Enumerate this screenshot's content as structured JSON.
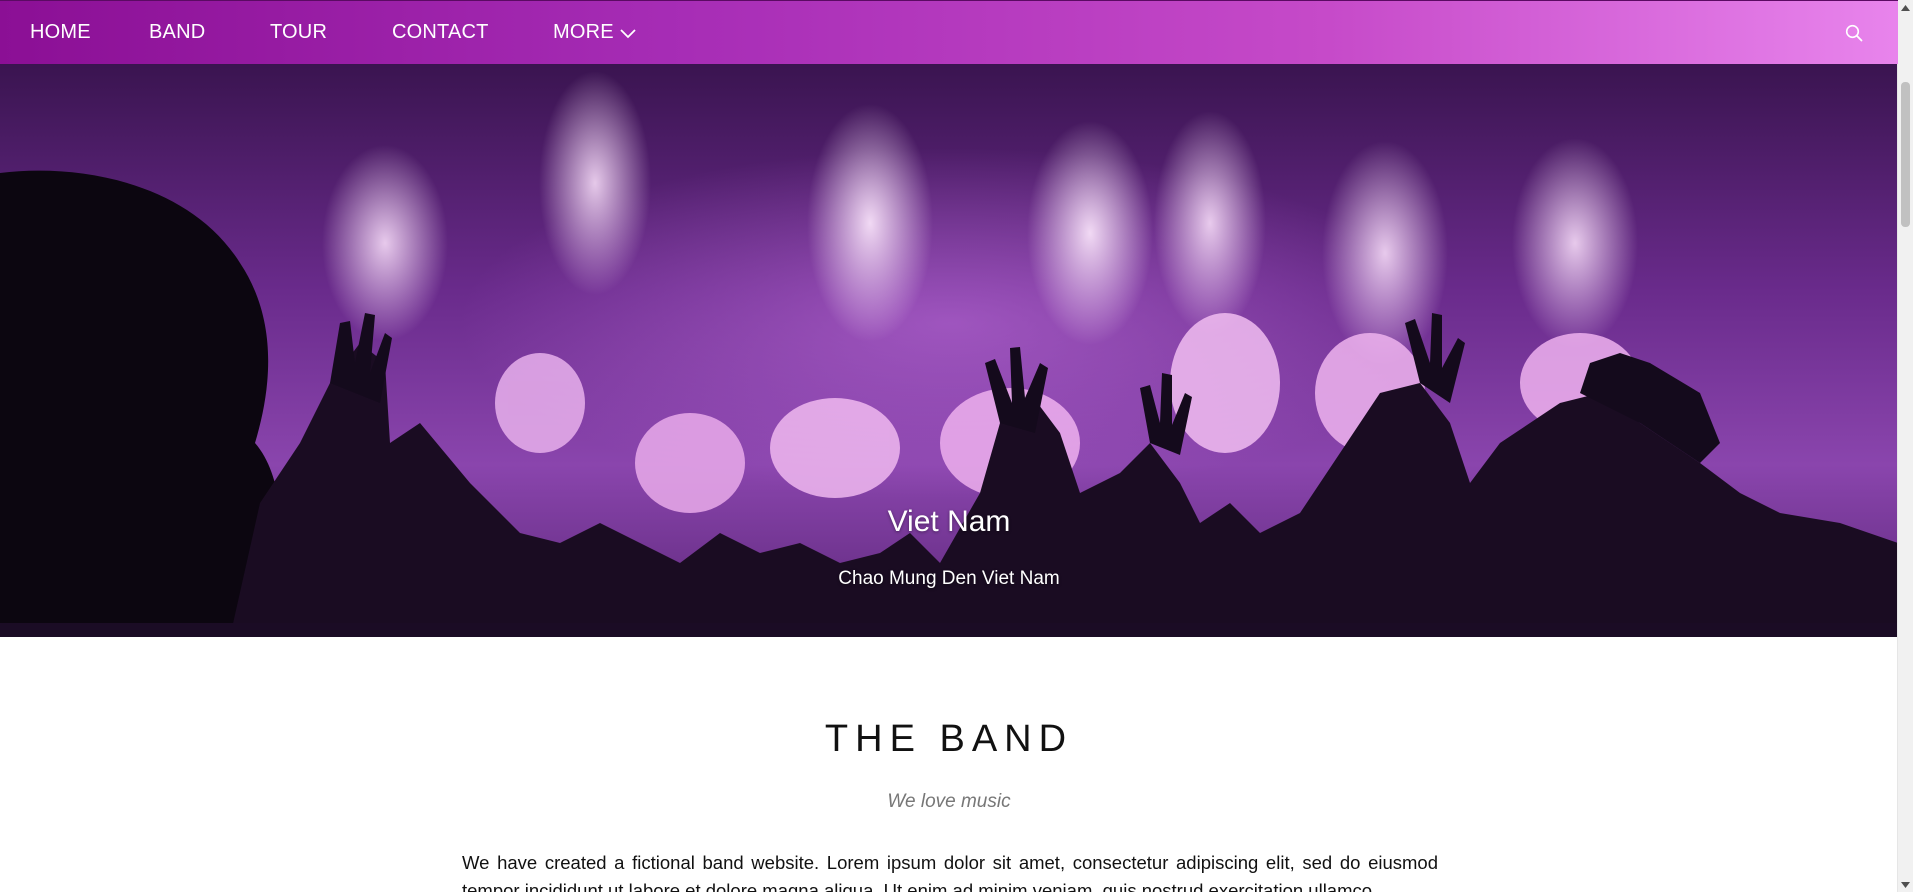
{
  "nav": {
    "items": [
      {
        "label": "HOME"
      },
      {
        "label": "BAND"
      },
      {
        "label": "TOUR"
      },
      {
        "label": "CONTACT"
      },
      {
        "label": "MORE"
      }
    ],
    "more_icon": "chevron-down-icon",
    "search_icon": "search-icon",
    "colors": {
      "start": "#8b0f95",
      "end": "#e884ec"
    }
  },
  "hero": {
    "title": "Viet Nam",
    "subtitle": "Chao Mung Den Viet Nam",
    "image": "concert-fireworks-crowd"
  },
  "band": {
    "title": "THE BAND",
    "tagline": "We love music",
    "description": "We have created a fictional band website. Lorem ipsum dolor sit amet, consectetur adipiscing elit, sed do eiusmod tempor incididunt ut labore et dolore magna aliqua. Ut enim ad minim veniam, quis nostrud exercitation ullamco"
  }
}
